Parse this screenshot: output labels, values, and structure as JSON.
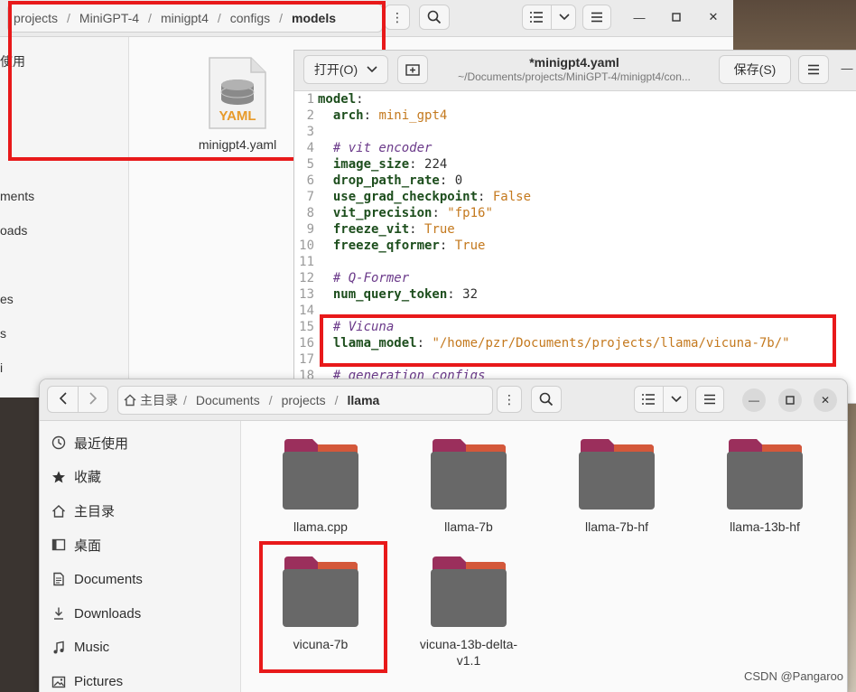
{
  "window_models": {
    "breadcrumb": [
      "projects",
      "MiniGPT-4",
      "minigpt4",
      "configs",
      "models"
    ],
    "sidebar_partial": [
      "使用",
      "ments",
      "oads",
      "es",
      "s",
      "i",
      "置"
    ],
    "file": {
      "name": "minigpt4.yaml",
      "icon": "yaml-file-icon",
      "badge": "YAML"
    }
  },
  "editor": {
    "open_label": "打开(O)",
    "title": "*minigpt4.yaml",
    "subtitle": "~/Documents/projects/MiniGPT-4/minigpt4/con...",
    "save_label": "保存(S)",
    "lines": [
      {
        "n": "1",
        "key": "model",
        "val": "",
        "comment": "",
        "indent": ""
      },
      {
        "n": "2",
        "key": "arch",
        "val": "mini_gpt4",
        "comment": "",
        "indent": "  "
      },
      {
        "n": "3",
        "key": "",
        "val": "",
        "comment": "",
        "indent": ""
      },
      {
        "n": "4",
        "key": "",
        "val": "",
        "comment": "# vit encoder",
        "indent": "  "
      },
      {
        "n": "5",
        "key": "image_size",
        "val": "224",
        "comment": "",
        "indent": "  "
      },
      {
        "n": "6",
        "key": "drop_path_rate",
        "val": "0",
        "comment": "",
        "indent": "  "
      },
      {
        "n": "7",
        "key": "use_grad_checkpoint",
        "val": "False",
        "comment": "",
        "indent": "  "
      },
      {
        "n": "8",
        "key": "vit_precision",
        "val": "\"fp16\"",
        "comment": "",
        "indent": "  "
      },
      {
        "n": "9",
        "key": "freeze_vit",
        "val": "True",
        "comment": "",
        "indent": "  "
      },
      {
        "n": "10",
        "key": "freeze_qformer",
        "val": "True",
        "comment": "",
        "indent": "  "
      },
      {
        "n": "11",
        "key": "",
        "val": "",
        "comment": "",
        "indent": ""
      },
      {
        "n": "12",
        "key": "",
        "val": "",
        "comment": "# Q-Former",
        "indent": "  "
      },
      {
        "n": "13",
        "key": "num_query_token",
        "val": "32",
        "comment": "",
        "indent": "  "
      },
      {
        "n": "14",
        "key": "",
        "val": "",
        "comment": "",
        "indent": ""
      },
      {
        "n": "15",
        "key": "",
        "val": "",
        "comment": "# Vicuna",
        "indent": "  "
      },
      {
        "n": "16",
        "key": "llama_model",
        "val": "\"/home/pzr/Documents/projects/llama/vicuna-7b/\"",
        "comment": "",
        "indent": "  "
      },
      {
        "n": "17",
        "key": "",
        "val": "",
        "comment": "",
        "indent": ""
      },
      {
        "n": "18",
        "key": "",
        "val": "",
        "comment": "# generation configs",
        "indent": "  "
      }
    ]
  },
  "window_llama": {
    "breadcrumb": {
      "home_label": "主目录",
      "parts": [
        "Documents",
        "projects",
        "llama"
      ]
    },
    "sidebar": [
      {
        "label": "最近使用",
        "icon": "clock-icon"
      },
      {
        "label": "收藏",
        "icon": "star-icon"
      },
      {
        "label": "主目录",
        "icon": "home-icon"
      },
      {
        "label": "桌面",
        "icon": "desktop-icon"
      },
      {
        "label": "Documents",
        "icon": "document-icon"
      },
      {
        "label": "Downloads",
        "icon": "download-icon"
      },
      {
        "label": "Music",
        "icon": "music-icon"
      },
      {
        "label": "Pictures",
        "icon": "picture-icon"
      }
    ],
    "folders": [
      "llama.cpp",
      "llama-7b",
      "llama-7b-hf",
      "llama-13b-hf",
      "vicuna-7b",
      "vicuna-13b-delta-v1.1"
    ]
  },
  "watermark": "CSDN @Pangaroo",
  "colors": {
    "highlight_box": "#e8191a",
    "folder_body": "#686868",
    "folder_tab": "#9b2f5c",
    "yaml_key": "#1d4e1d",
    "yaml_value": "#c4791e",
    "yaml_comment": "#6b3a8a"
  }
}
